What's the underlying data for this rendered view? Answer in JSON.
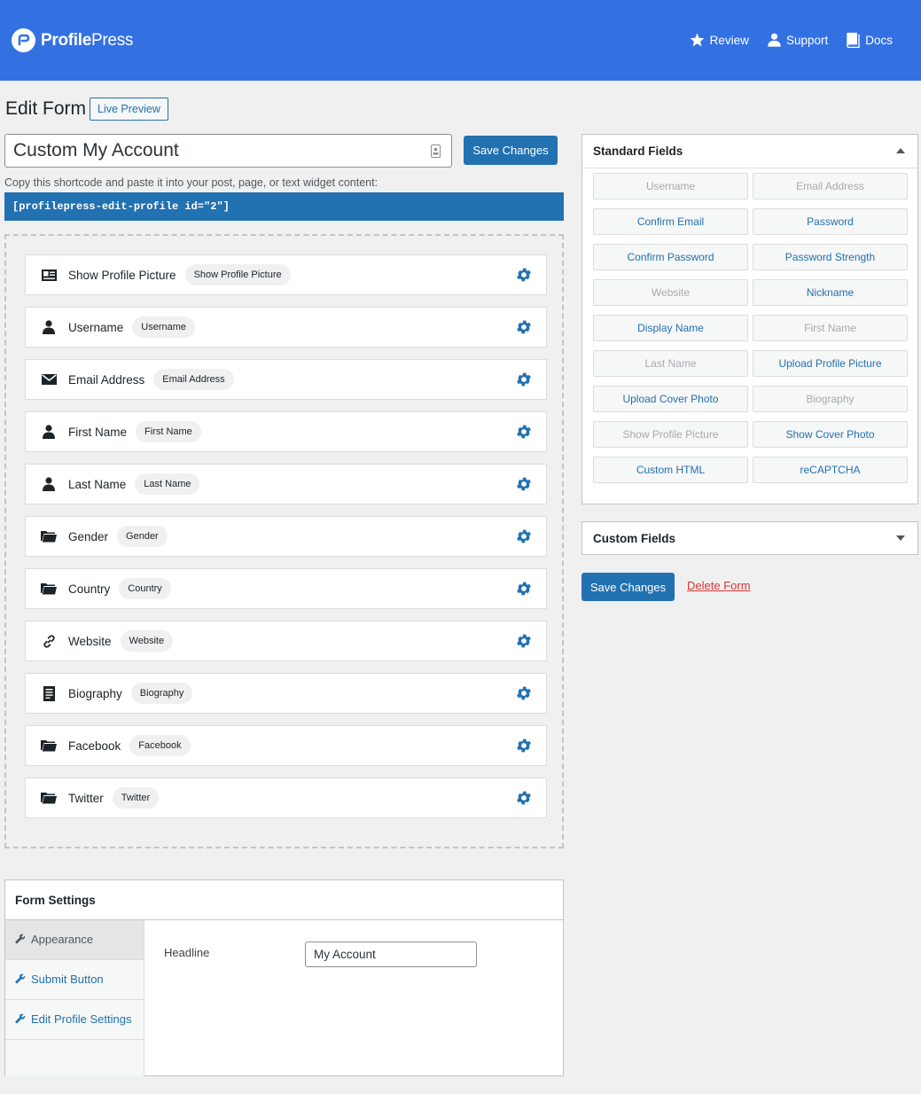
{
  "header": {
    "brand_bold": "Profile",
    "brand_light": "Press",
    "links": [
      {
        "label": "Review",
        "icon": "star-icon"
      },
      {
        "label": "Support",
        "icon": "user-icon"
      },
      {
        "label": "Docs",
        "icon": "book-icon"
      }
    ],
    "background_color": "#3371e3"
  },
  "page": {
    "title": "Edit Form",
    "live_preview_label": "Live Preview",
    "form_name": "Custom My Account",
    "save_label": "Save Changes",
    "copy_hint": "Copy this shortcode and paste it into your post, page, or text widget content:",
    "shortcode": "[profilepress-edit-profile id=\"2\"]"
  },
  "fields": [
    {
      "label": "Show Profile Picture",
      "tag": "Show Profile Picture",
      "icon": "id-card-icon"
    },
    {
      "label": "Username",
      "tag": "Username",
      "icon": "user-icon"
    },
    {
      "label": "Email Address",
      "tag": "Email Address",
      "icon": "envelope-icon"
    },
    {
      "label": "First Name",
      "tag": "First Name",
      "icon": "user-icon"
    },
    {
      "label": "Last Name",
      "tag": "Last Name",
      "icon": "user-icon"
    },
    {
      "label": "Gender",
      "tag": "Gender",
      "icon": "folder-icon"
    },
    {
      "label": "Country",
      "tag": "Country",
      "icon": "folder-icon"
    },
    {
      "label": "Website",
      "tag": "Website",
      "icon": "link-icon"
    },
    {
      "label": "Biography",
      "tag": "Biography",
      "icon": "document-icon"
    },
    {
      "label": "Facebook",
      "tag": "Facebook",
      "icon": "folder-icon"
    },
    {
      "label": "Twitter",
      "tag": "Twitter",
      "icon": "folder-icon"
    }
  ],
  "standard_fields": {
    "title": "Standard Fields",
    "items": [
      {
        "label": "Username",
        "state": "disabled"
      },
      {
        "label": "Email Address",
        "state": "disabled"
      },
      {
        "label": "Confirm Email",
        "state": "active"
      },
      {
        "label": "Password",
        "state": "active"
      },
      {
        "label": "Confirm Password",
        "state": "active"
      },
      {
        "label": "Password Strength",
        "state": "active"
      },
      {
        "label": "Website",
        "state": "disabled"
      },
      {
        "label": "Nickname",
        "state": "active"
      },
      {
        "label": "Display Name",
        "state": "active"
      },
      {
        "label": "First Name",
        "state": "disabled"
      },
      {
        "label": "Last Name",
        "state": "disabled"
      },
      {
        "label": "Upload Profile Picture",
        "state": "active"
      },
      {
        "label": "Upload Cover Photo",
        "state": "active"
      },
      {
        "label": "Biography",
        "state": "disabled"
      },
      {
        "label": "Show Profile Picture",
        "state": "disabled"
      },
      {
        "label": "Show Cover Photo",
        "state": "active"
      },
      {
        "label": "Custom HTML",
        "state": "active"
      },
      {
        "label": "reCAPTCHA",
        "state": "active"
      }
    ]
  },
  "custom_fields": {
    "title": "Custom Fields"
  },
  "actions": {
    "save_label": "Save Changes",
    "delete_label": "Delete Form"
  },
  "form_settings": {
    "title": "Form Settings",
    "tabs": [
      {
        "label": "Appearance",
        "active": true
      },
      {
        "label": "Submit Button",
        "active": false
      },
      {
        "label": "Edit Profile Settings",
        "active": false
      }
    ],
    "headline_label": "Headline",
    "headline_value": "My Account"
  },
  "colors": {
    "primary": "#2271b1",
    "danger": "#d63638"
  }
}
